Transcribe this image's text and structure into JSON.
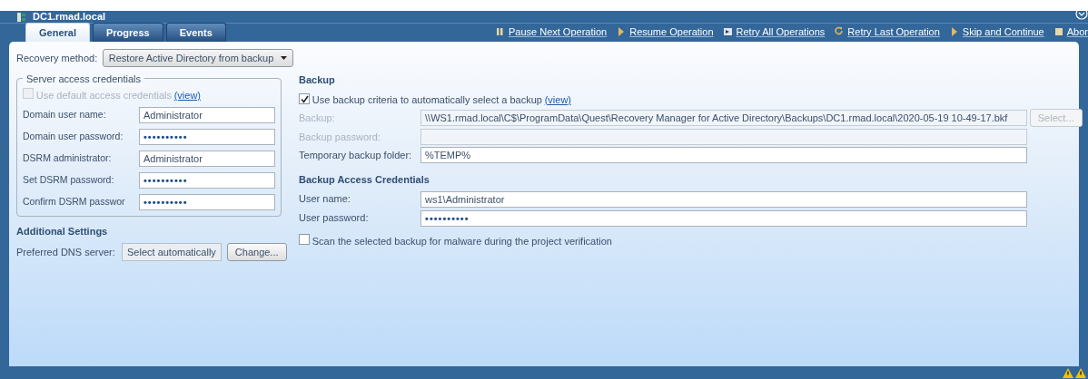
{
  "window": {
    "title": "DC1.rmad.local"
  },
  "tabs": [
    {
      "label": "General",
      "selected": true
    },
    {
      "label": "Progress",
      "selected": false
    },
    {
      "label": "Events",
      "selected": false
    }
  ],
  "toolbar": [
    {
      "label": "Pause Next Operation",
      "kind": "pause"
    },
    {
      "label": "Resume Operation",
      "kind": "play"
    },
    {
      "label": "Retry All Operations",
      "kind": "retry-all"
    },
    {
      "label": "Retry Last Operation",
      "kind": "retry"
    },
    {
      "label": "Skip and Continue",
      "kind": "play"
    },
    {
      "label": "Abor",
      "kind": "stop"
    }
  ],
  "recovery_method": {
    "label": "Recovery method:",
    "value": "Restore Active Directory from backup"
  },
  "server_credentials": {
    "title": "Server access credentials",
    "use_default": {
      "label": "Use default access credentials",
      "link": "(view)",
      "checked": false,
      "disabled": true
    },
    "fields": [
      {
        "label": "Domain user name:",
        "value": "Administrator"
      },
      {
        "label": "Domain user password:",
        "value": "••••••••••"
      },
      {
        "label": "DSRM administrator:",
        "value": "Administrator"
      },
      {
        "label": "Set DSRM password:",
        "value": "••••••••••"
      },
      {
        "label": "Confirm DSRM passwor",
        "value": "••••••••••"
      }
    ]
  },
  "additional_settings": {
    "title": "Additional Settings",
    "dns": {
      "label": "Preferred DNS server:",
      "value": "Select automatically",
      "button": "Change..."
    }
  },
  "backup": {
    "title": "Backup",
    "use_criteria": {
      "label": "Use backup criteria to automatically select a backup",
      "link": "(view)",
      "checked": true,
      "disabled": false
    },
    "fields": [
      {
        "label": "Backup:",
        "value": "\\\\WS1.rmad.local\\C$\\ProgramData\\Quest\\Recovery Manager for Active Directory\\Backups\\DC1.rmad.local\\2020-05-19 10-49-17.bkf",
        "disabled": true
      },
      {
        "label": "Backup password:",
        "disabled": true
      },
      {
        "label": "Temporary backup folder:",
        "value": "%TEMP%",
        "disabled": false
      }
    ],
    "select_button": {
      "label": "Select...",
      "disabled": true
    }
  },
  "access_credentials": {
    "title": "Backup Access Credentials",
    "fields": [
      {
        "label": "User name:",
        "value": "ws1\\Administrator"
      },
      {
        "label": "User password:",
        "value": "••••••••••"
      }
    ]
  },
  "scan_malware": {
    "label": "Scan the selected backup for malware during the project verification",
    "checked": false,
    "disabled": false
  }
}
